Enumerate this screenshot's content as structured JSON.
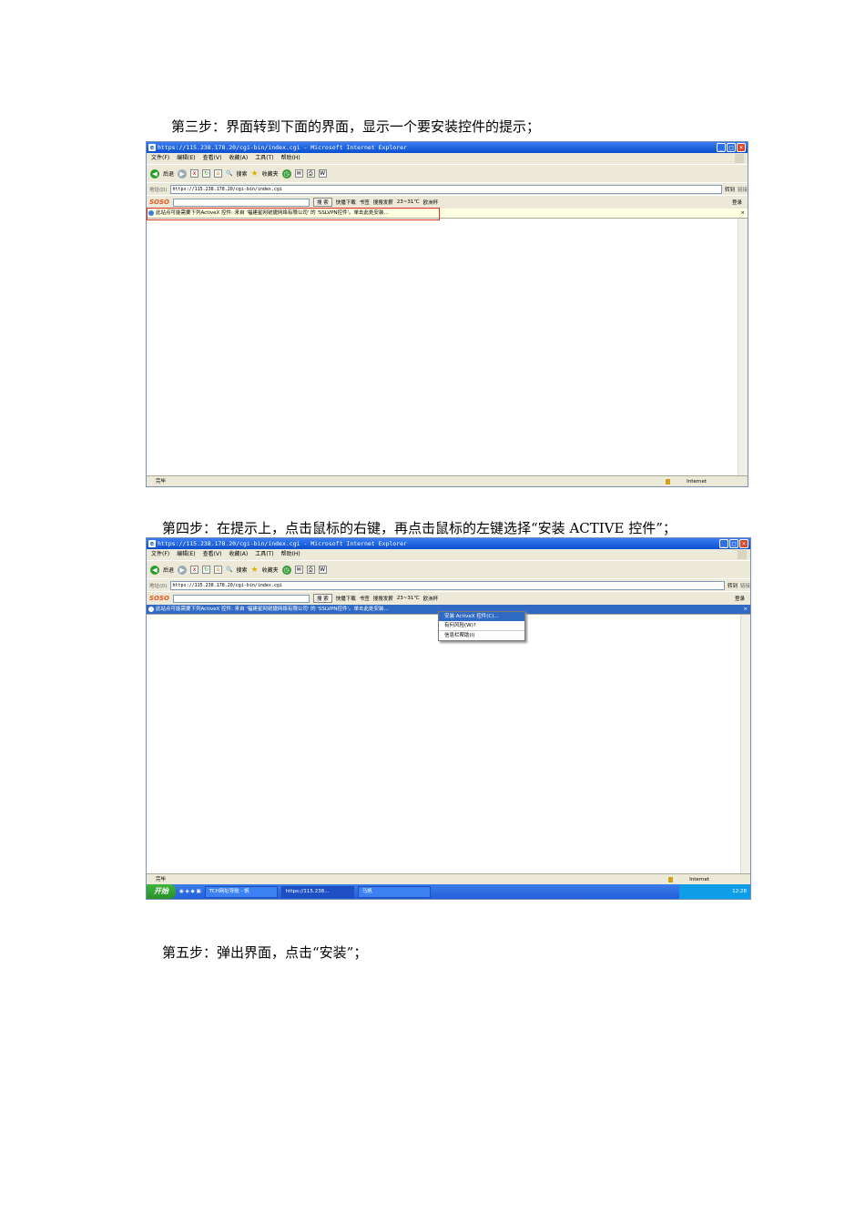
{
  "steps": {
    "step3": "第三步：界面转到下面的界面，显示一个要安装控件的提示；",
    "step4": "第四步：在提示上，点击鼠标的右键，再点击鼠标的左键选择“安装  ACTIVE 控件”；",
    "step5": "第五步：弹出界面，点击“安装”；"
  },
  "browser": {
    "title": "https://115.238.178.20/cgi-bin/index.cgi - Microsoft Internet Explorer",
    "menu": [
      "文件(F)",
      "编辑(E)",
      "查看(V)",
      "收藏(A)",
      "工具(T)",
      "帮助(H)"
    ],
    "toolbar": {
      "back": "后退",
      "search": "搜索",
      "favorites": "收藏夹"
    },
    "address_label": "地址(D)",
    "address": "https://115.238.178.20/cgi-bin/index.cgi",
    "go": "转到",
    "links": "链接",
    "soso": {
      "logo": "SOSO",
      "search_btn": "搜 索",
      "items": [
        "快播下载",
        "书签",
        "搜搜发薪",
        "23~31℃",
        "欧洲杯"
      ],
      "login": "登录"
    },
    "infobar_text": "此站点可能需要下列ActiveX 控件: 来自 '福建星网锐捷网络有限公司' 的 'SSLVPN控件'。单击此处安装...",
    "status_done": "完毕",
    "status_zone": "Internet"
  },
  "context_menu": [
    "安装 ActiveX 控件(C)...",
    "有何风险(W)?",
    "信息栏帮助(I)"
  ],
  "taskbar": {
    "start": "开始",
    "tasks": [
      "TCH网址导航 - 帆",
      "https://115.238...",
      "马帆"
    ],
    "clock": "12:28"
  },
  "colors": {
    "highlight_box": "#e0302a",
    "xp_blue": "#0a4fd0",
    "selection": "#316ac5"
  }
}
